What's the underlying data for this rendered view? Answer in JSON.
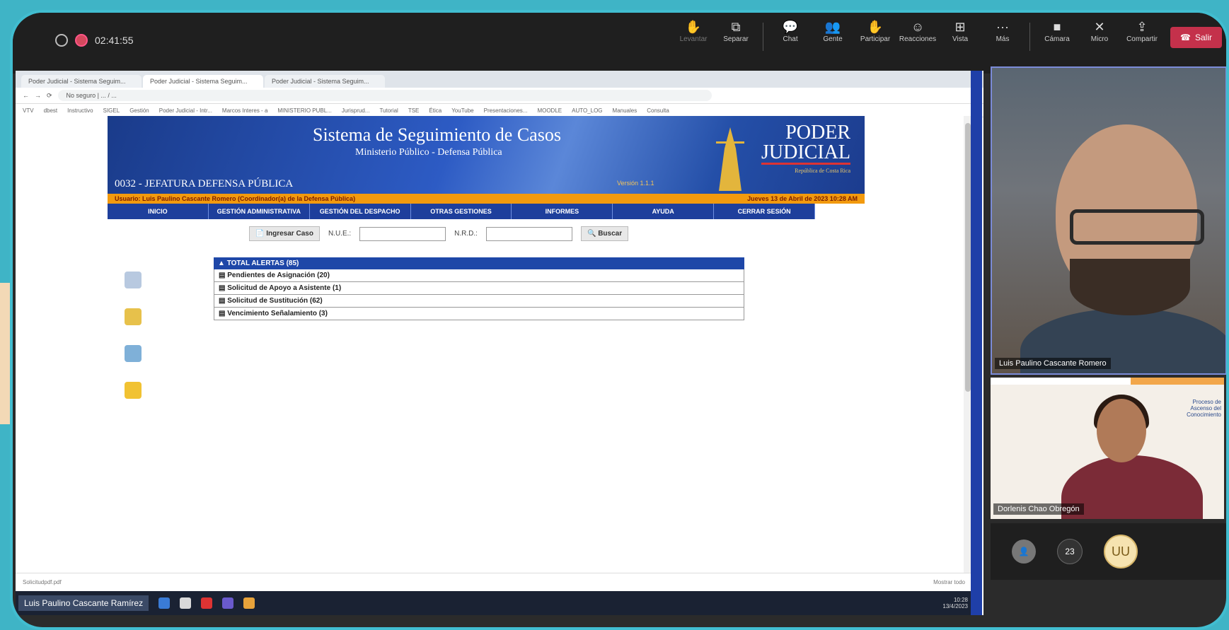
{
  "meeting": {
    "timer": "02:41:55",
    "toolbar": [
      {
        "label": "Levantar",
        "icon": "hand-icon",
        "dim": true
      },
      {
        "label": "Separar",
        "icon": "pop-out-icon",
        "dim": false
      },
      {
        "label": "Chat",
        "icon": "chat-icon",
        "dim": false
      },
      {
        "label": "Gente",
        "icon": "people-icon",
        "dim": false
      },
      {
        "label": "Participar",
        "icon": "raise-hand-icon",
        "dim": false
      },
      {
        "label": "Reacciones",
        "icon": "emoji-icon",
        "dim": false
      },
      {
        "label": "Vista",
        "icon": "grid-icon",
        "dim": false
      },
      {
        "label": "Más",
        "icon": "more-icon",
        "dim": false
      },
      {
        "label": "Cámara",
        "icon": "camera-icon",
        "dim": false
      },
      {
        "label": "Micro",
        "icon": "mic-off-icon",
        "dim": false
      },
      {
        "label": "Compartir",
        "icon": "share-icon",
        "dim": false
      }
    ],
    "leave_label": "Salir"
  },
  "browser": {
    "tabs": [
      "Poder Judicial - Sistema Seguim...",
      "Poder Judicial - Sistema Seguim...",
      "Poder Judicial - Sistema Seguim..."
    ],
    "url": "No seguro | ... / ...",
    "bookmarks": [
      "VTV",
      "dbest",
      "Instructivo",
      "SIGEL",
      "Gestión",
      "Poder Judicial - Intr...",
      "Marcos Interes - a",
      "MINISTERIO PUBL...",
      "Jurisprud...",
      "Tutorial",
      "TSE",
      "Ética",
      "YouTube",
      "Presentaciones...",
      "MOODLE",
      "AUTO_LOG",
      "Manuales",
      "Consulta"
    ]
  },
  "sistema": {
    "title": "Sistema de Seguimiento de Casos",
    "subtitle": "Ministerio Público - Defensa Pública",
    "office": "0032 - JEFATURA DEFENSA PÚBLICA",
    "version": "Versión 1.1.1",
    "logo_line1": "PODER",
    "logo_line2": "JUDICIAL",
    "logo_line3": "República de Costa Rica",
    "user_text": "Usuario: Luis Paulino Cascante Romero (Coordinador(a) de la Defensa Pública)",
    "date_text": "Jueves 13 de Abril de 2023   10:28 AM",
    "menu": [
      "INICIO",
      "GESTIÓN ADMINISTRATIVA",
      "GESTIÓN DEL DESPACHO",
      "OTRAS GESTIONES",
      "INFORMES",
      "AYUDA",
      "CERRAR SESIÓN"
    ],
    "ingresar_label": "Ingresar Caso",
    "nue_label": "N.U.E.:",
    "nrd_label": "N.R.D.:",
    "buscar_label": "Buscar",
    "alerts_header": "TOTAL ALERTAS (85)",
    "alerts": [
      "Pendientes de Asignación (20)",
      "Solicitud de Apoyo a Asistente (1)",
      "Solicitud de Sustitución (62)",
      "Vencimiento Señalamiento (3)"
    ]
  },
  "footer": {
    "download": "Solicitudpdf.pdf",
    "show_all": "Mostrar todo"
  },
  "taskbar": {
    "who": "Luis Paulino Cascante Ramírez",
    "time": "10:28",
    "date": "13/4/2023"
  },
  "participants": {
    "main_name": "Luis Paulino Cascante Romero",
    "second_name": "Dorlenis Chao Obregón",
    "slide_text": "Proceso de Ascenso del Conocimiento",
    "overflow_count": "23",
    "initials": "UU"
  },
  "colors": {
    "frame": "#41bdd0",
    "menu_blue": "#1e3f9c",
    "orange_bar": "#f29a0e",
    "leave_red": "#c4314b"
  }
}
